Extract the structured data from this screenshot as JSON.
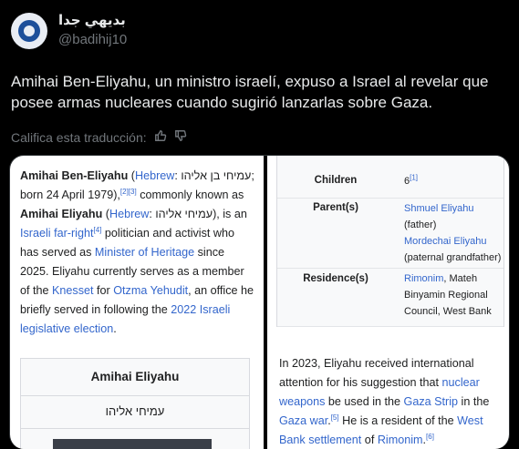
{
  "author": {
    "display_name": "بديهي جدا",
    "handle": "@badihij10"
  },
  "tweet": {
    "text": "Amihai Ben-Eliyahu, un ministro israelí, expuso a Israel al revelar que posee armas nucleares cuando sugirió lanzarlas sobre Gaza.",
    "rate_prompt": "Califica esta traducción:",
    "icons": [
      "thumbs-up-icon",
      "thumbs-down-icon"
    ]
  },
  "left_panel": {
    "name_bold": "Amihai Ben-Eliyahu",
    "open_paren": " (",
    "hebrew_link": "Hebrew",
    "hebrew_name": ": עמיחי בן אליהו;",
    "born": "born 24 April 1979),",
    "ref1": "[2][3]",
    "commonly": " commonly known as ",
    "name_bold2": "Amihai Eliyahu",
    "paren2": " (",
    "hebrew_link2": "Hebrew",
    "hebrew_name2": ": עמיחי אליהו",
    "close2": "), is an ",
    "far_right_link": "Israeli far-right",
    "ref4": "[4]",
    "politician": " politician and activist who has served as ",
    "minister_link": "Minister of Heritage",
    "since": " since 2025. Eliyahu currently serves as a member of the ",
    "knesset_link": "Knesset",
    "for": " for ",
    "otzma_link": "Otzma Yehudit",
    "office": ", an office he briefly served in following the ",
    "election_link": "2022 Israeli legislative election",
    "period": ".",
    "infobox": {
      "title": "Amihai Eliyahu",
      "hebrew": "עמיחי אליהו"
    }
  },
  "right_panel": {
    "rows": [
      {
        "key": "Children",
        "value": "6",
        "ref": "[1]"
      },
      {
        "key": "Parent(s)",
        "link1": "Shmuel Eliyahu",
        "note1": "(father)",
        "link2": "Mordechai Eliyahu",
        "note2": "(paternal grandfather)"
      },
      {
        "key": "Residence(s)",
        "link1": "Rimonim",
        "rest": ", Mateh Binyamin Regional Council, West Bank"
      }
    ],
    "p_start": "In 2023, Eliyahu received international attention for his suggestion that ",
    "nuclear_link": "nuclear weapons",
    "used_in": " be used in the ",
    "gaza_strip_link": "Gaza Strip",
    "in_the": " in the ",
    "gaza_war_link": "Gaza war",
    "ref5": "[5]",
    "resident": " He is a resident of the ",
    "settlement_link": "West Bank settlement",
    "of": " of ",
    "rimonim_link": "Rimonim",
    "end": ".",
    "ref6": "[6]"
  }
}
